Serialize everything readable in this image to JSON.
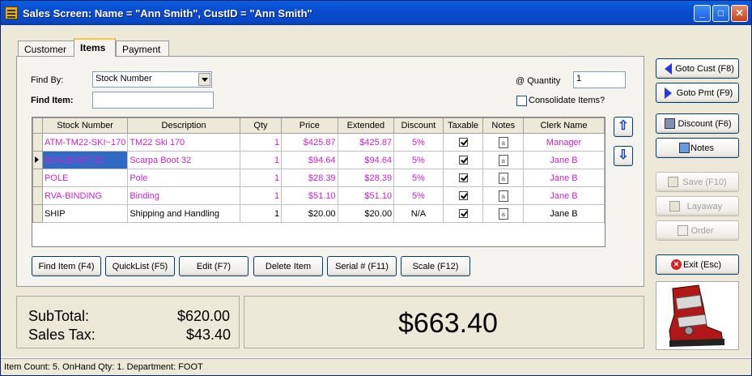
{
  "window": {
    "title": "Sales Screen:  Name = \"Ann Smith\", CustID = \"Ann Smith\"",
    "min": "_",
    "max": "□",
    "close": "✕"
  },
  "tabs": [
    {
      "label": "Customer",
      "active": false
    },
    {
      "label": "Items",
      "active": true
    },
    {
      "label": "Payment",
      "active": false
    }
  ],
  "find": {
    "find_by_label": "Find By:",
    "find_by_value": "Stock Number",
    "find_item_label": "Find  Item:",
    "find_item_value": "",
    "quantity_label": "@ Quantity",
    "quantity_value": "1",
    "consolidate_label": "Consolidate Items?"
  },
  "grid": {
    "columns": [
      "Stock Number",
      "Description",
      "Qty",
      "Price",
      "Extended",
      "Discount",
      "Taxable",
      "Notes",
      "Clerk Name"
    ],
    "rows": [
      {
        "stock": "ATM-TM22-SKI~170",
        "desc": "TM22 Ski 170",
        "qty": "1",
        "price": "$425.87",
        "ext": "$425.87",
        "disc": "5%",
        "clerk": "Manager",
        "pink": true
      },
      {
        "stock": "SCA-BOOT-32",
        "desc": "Scarpa Boot 32",
        "qty": "1",
        "price": "$94.64",
        "ext": "$94.64",
        "disc": "5%",
        "clerk": "Jane B",
        "pink": true,
        "selected": true
      },
      {
        "stock": "POLE",
        "desc": "Pole",
        "qty": "1",
        "price": "$28.39",
        "ext": "$28.39",
        "disc": "5%",
        "clerk": "Jane B",
        "pink": true
      },
      {
        "stock": "RVA-BINDING",
        "desc": "Binding",
        "qty": "1",
        "price": "$51.10",
        "ext": "$51.10",
        "disc": "5%",
        "clerk": "Jane B",
        "pink": true
      },
      {
        "stock": "SHIP",
        "desc": "Shipping and Handling",
        "qty": "1",
        "price": "$20.00",
        "ext": "$20.00",
        "disc": "N/A",
        "clerk": "Jane B",
        "pink": false
      }
    ],
    "note_glyph": "a"
  },
  "actions": {
    "find_item": "Find Item (F4)",
    "quicklist": "QuickList (F5)",
    "edit": "Edit (F7)",
    "delete": "Delete Item",
    "serial": "Serial # (F11)",
    "scale": "Scale (F12)"
  },
  "side": {
    "goto_cust": "Goto Cust (F8)",
    "goto_pmt": "Goto Pmt (F9)",
    "discount": "Discount (F6)",
    "notes": "Notes",
    "save": "Save (F10)",
    "layaway": "Layaway",
    "order": "Order",
    "exit": "Exit (Esc)"
  },
  "totals": {
    "subtotal_label": "SubTotal:",
    "subtotal_value": "$620.00",
    "tax_label": "Sales Tax:",
    "tax_value": "$43.40",
    "grand_total": "$663.40"
  },
  "status": "Item Count: 5.  OnHand Qty: 1.  Department: FOOT",
  "colors": {
    "pink_text": "#d020d0",
    "selection": "#316ac5",
    "titlebar": "#0a4bd0"
  }
}
